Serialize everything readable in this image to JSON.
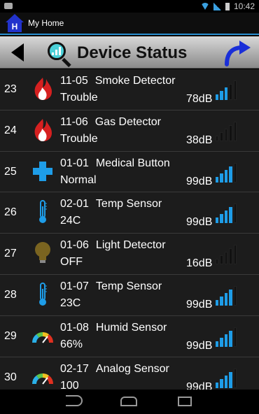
{
  "status_bar": {
    "time": "10:42"
  },
  "app_bar": {
    "title": "My Home",
    "icon_letter": "H"
  },
  "toolbar": {
    "title": "Device Status"
  },
  "devices": [
    {
      "num": "23",
      "code": "11-05",
      "name": "Smoke Detector",
      "status": "Trouble",
      "db": "78dB",
      "signal": 3,
      "icon": "fire-icon"
    },
    {
      "num": "24",
      "code": "11-06",
      "name": "Gas Detector",
      "status": "Trouble",
      "db": "38dB",
      "signal": 0,
      "icon": "fire-icon"
    },
    {
      "num": "25",
      "code": "01-01",
      "name": "Medical Button",
      "status": "Normal",
      "db": "99dB",
      "signal": 4,
      "icon": "medical-cross-icon"
    },
    {
      "num": "26",
      "code": "02-01",
      "name": "Temp Sensor",
      "status": "24C",
      "db": "99dB",
      "signal": 4,
      "icon": "thermometer-icon"
    },
    {
      "num": "27",
      "code": "01-06",
      "name": "Light Detector",
      "status": "OFF",
      "db": "16dB",
      "signal": 0,
      "icon": "light-bulb-icon"
    },
    {
      "num": "28",
      "code": "01-07",
      "name": "Temp Sensor",
      "status": "23C",
      "db": "99dB",
      "signal": 4,
      "icon": "thermometer-icon"
    },
    {
      "num": "29",
      "code": "01-08",
      "name": "Humid Sensor",
      "status": "66%",
      "db": "99dB",
      "signal": 4,
      "icon": "gauge-icon"
    },
    {
      "num": "30",
      "code": "02-17",
      "name": "Analog Sensor",
      "status": "100",
      "db": "99dB",
      "signal": 4,
      "icon": "gauge-icon"
    }
  ],
  "colors": {
    "accent": "#2a8fd0",
    "signal_on": "#1e9de8",
    "app_icon": "#2233cc"
  }
}
